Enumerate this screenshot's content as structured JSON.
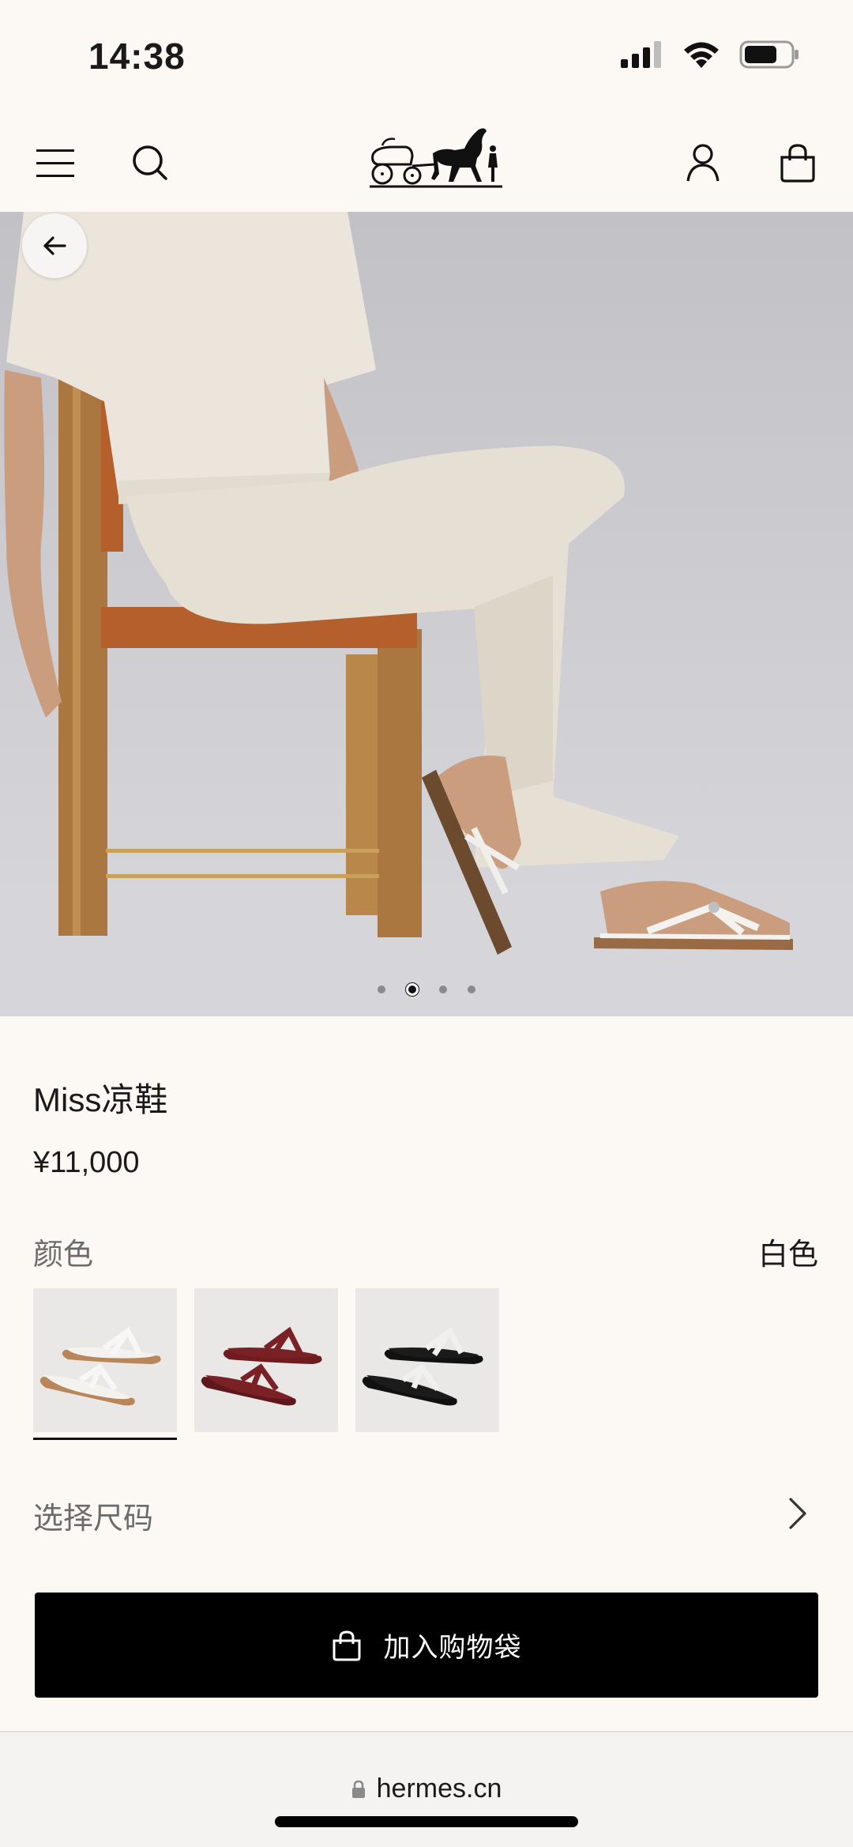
{
  "status_bar": {
    "time": "14:38"
  },
  "header": {
    "menu_icon": "hamburger-menu-icon",
    "search_icon": "search-icon",
    "logo": "hermes-carriage-logo",
    "account_icon": "account-icon",
    "bag_icon": "shopping-bag-icon"
  },
  "hero": {
    "slide_count": 4,
    "active_slide": 2
  },
  "product": {
    "name": "Miss凉鞋",
    "price": "¥11,000"
  },
  "color": {
    "label": "颜色",
    "selected": "白色",
    "swatches": [
      {
        "id": "white",
        "sole": "#b8865a",
        "strap": "#f7f7f5",
        "bed": "#f4f2ee"
      },
      {
        "id": "burgundy",
        "sole": "#6e1c20",
        "strap": "#7a2126",
        "bed": "#7a2126"
      },
      {
        "id": "black",
        "sole": "#111111",
        "strap": "#f0f0ee",
        "bed": "#151515"
      }
    ]
  },
  "size": {
    "label": "选择尺码"
  },
  "cart": {
    "label": "加入购物袋"
  },
  "browser": {
    "url": "hermes.cn"
  }
}
